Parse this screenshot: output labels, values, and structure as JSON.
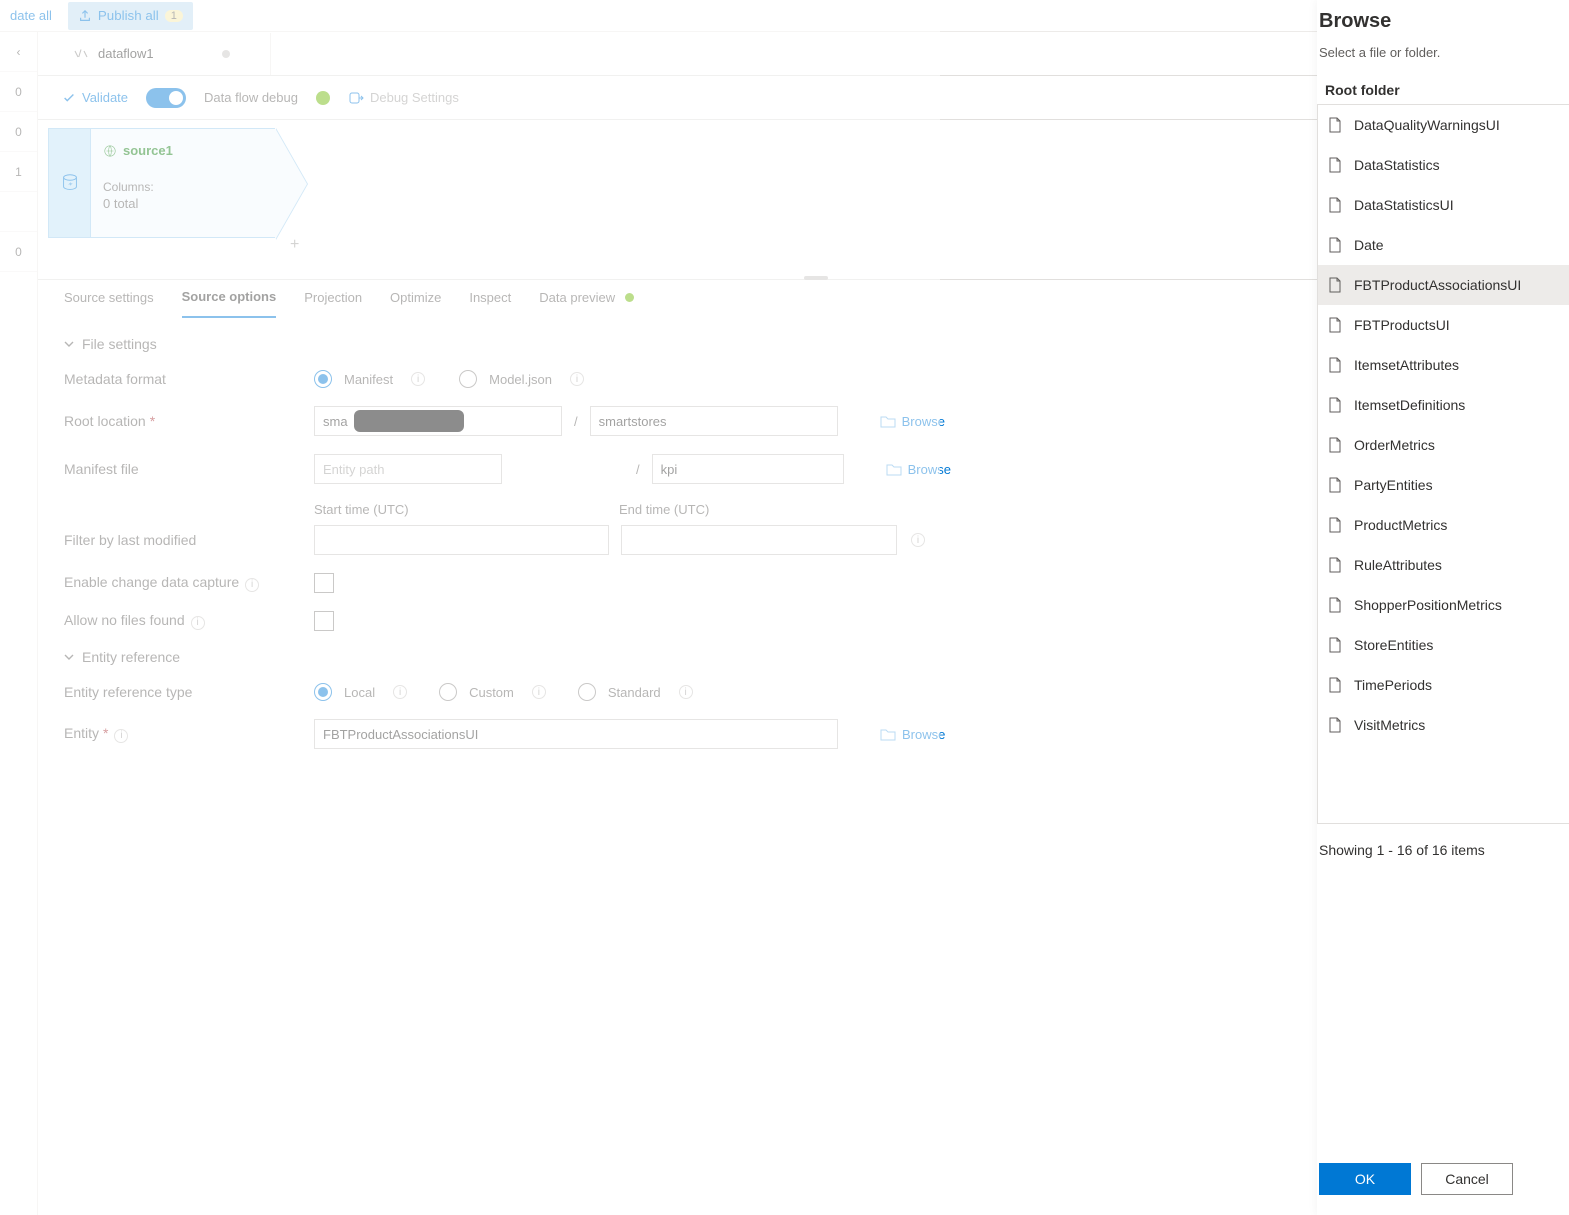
{
  "topbar": {
    "validate_all": "date all",
    "publish_all": "Publish all",
    "publish_badge": "1"
  },
  "leftrail": {
    "chev": "‹",
    "counts": [
      "0",
      "0",
      "1",
      "",
      "0"
    ]
  },
  "tab": {
    "name": "dataflow1"
  },
  "toolbar": {
    "validate": "Validate",
    "debug": "Data flow debug",
    "debug_settings": "Debug Settings"
  },
  "node": {
    "title": "source1",
    "columns_label": "Columns:",
    "columns_total": "0 total",
    "plus": "+"
  },
  "detail_tabs": [
    "Source settings",
    "Source options",
    "Projection",
    "Optimize",
    "Inspect",
    "Data preview"
  ],
  "form": {
    "sections": {
      "file_settings": "File settings",
      "entity_reference": "Entity reference"
    },
    "labels": {
      "metadata_format": "Metadata format",
      "root_location": "Root location",
      "manifest_file": "Manifest file",
      "filter_last_modified": "Filter by last modified",
      "enable_cdc": "Enable change data capture",
      "allow_no_files": "Allow no files found",
      "entity_ref_type": "Entity reference type",
      "entity": "Entity",
      "start_time": "Start time (UTC)",
      "end_time": "End time (UTC)"
    },
    "radios": {
      "manifest": "Manifest",
      "modeljson": "Model.json",
      "local": "Local",
      "custom": "Custom",
      "standard": "Standard"
    },
    "inputs": {
      "root_a": "sma",
      "root_b": "smartstores",
      "entity_path_placeholder": "Entity path",
      "manifest_name": "kpi",
      "entity_value": "FBTProductAssociationsUI"
    },
    "links": {
      "browse": "Browse"
    },
    "sep": "/"
  },
  "side": {
    "title": "Browse",
    "subtitle": "Select a file or folder.",
    "root_header": "Root folder",
    "items": [
      "DataQualityWarningsUI",
      "DataStatistics",
      "DataStatisticsUI",
      "Date",
      "FBTProductAssociationsUI",
      "FBTProductsUI",
      "ItemsetAttributes",
      "ItemsetDefinitions",
      "OrderMetrics",
      "PartyEntities",
      "ProductMetrics",
      "RuleAttributes",
      "ShopperPositionMetrics",
      "StoreEntities",
      "TimePeriods",
      "VisitMetrics"
    ],
    "selected_index": 4,
    "showing": "Showing 1 - 16 of 16 items",
    "ok": "OK",
    "cancel": "Cancel"
  }
}
